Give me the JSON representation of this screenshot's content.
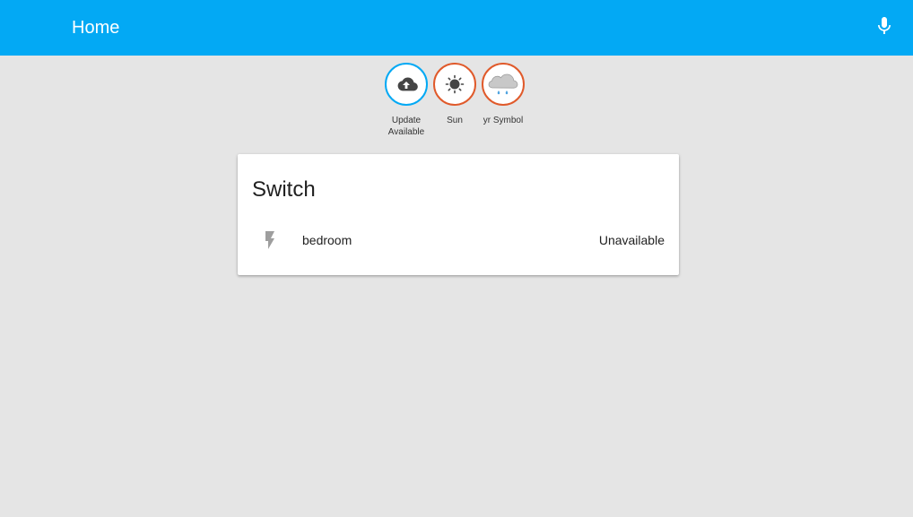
{
  "header": {
    "title": "Home",
    "mic_icon": "microphone-icon"
  },
  "badges": [
    {
      "label": "Update Available",
      "icon": "cloud-upload-icon",
      "ring_color": "#03a9f4"
    },
    {
      "label": "Sun",
      "icon": "sun-icon",
      "ring_color": "#e05a2b"
    },
    {
      "label": "yr Symbol",
      "icon": "rain-cloud-icon",
      "ring_color": "#e05a2b"
    }
  ],
  "card": {
    "title": "Switch",
    "entities": [
      {
        "name": "bedroom",
        "state": "Unavailable",
        "icon": "flash-icon"
      }
    ]
  },
  "colors": {
    "primary": "#03a9f4",
    "background": "#e5e5e5",
    "badge_accent": "#e05a2b"
  }
}
